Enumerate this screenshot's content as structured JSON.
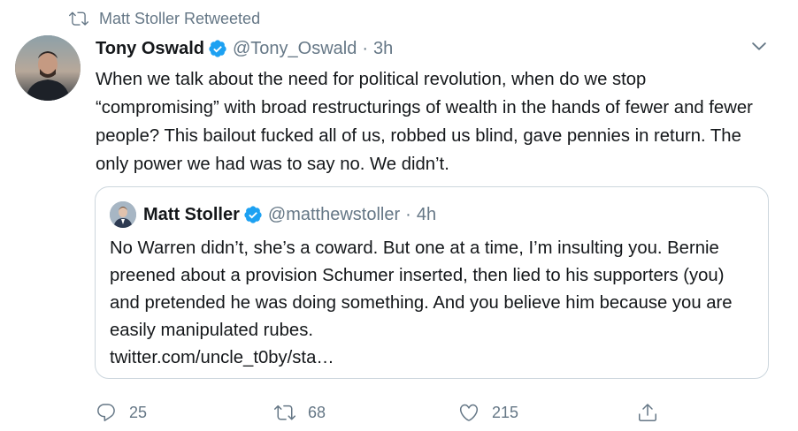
{
  "retweet_context": {
    "label": "Matt Stoller Retweeted"
  },
  "tweet": {
    "author_name": "Tony Oswald",
    "author_handle": "@Tony_Oswald",
    "separator": "·",
    "time": "3h",
    "text": "When we talk about the need for political revolution, when do we stop “compromising” with broad restructurings of wealth in the hands of fewer and fewer people? This bailout fucked all of us, robbed us blind, gave pennies in return. The only power we had was to say no. We didn’t."
  },
  "quoted_tweet": {
    "author_name": "Matt Stoller",
    "author_handle": "@matthewstoller",
    "separator": "·",
    "time": "4h",
    "text": "No Warren didn’t, she’s a coward. But one at a time, I’m insulting you. Bernie preened about a provision Schumer inserted, then lied to his supporters (you) and pretended he was doing something. And you believe him because you are easily manipulated rubes.",
    "link": "twitter.com/uncle_t0by/sta…"
  },
  "actions": {
    "reply_count": "25",
    "retweet_count": "68",
    "like_count": "215"
  },
  "colors": {
    "text": "#14171a",
    "secondary": "#657786",
    "verified": "#1da1f2",
    "border": "#ccd6dd"
  },
  "icons": {
    "retweet_context": "retweet-icon",
    "verified": "verified-badge-icon",
    "caret": "chevron-down-icon",
    "reply": "reply-icon",
    "retweet": "retweet-icon",
    "like": "heart-icon",
    "share": "share-icon"
  }
}
